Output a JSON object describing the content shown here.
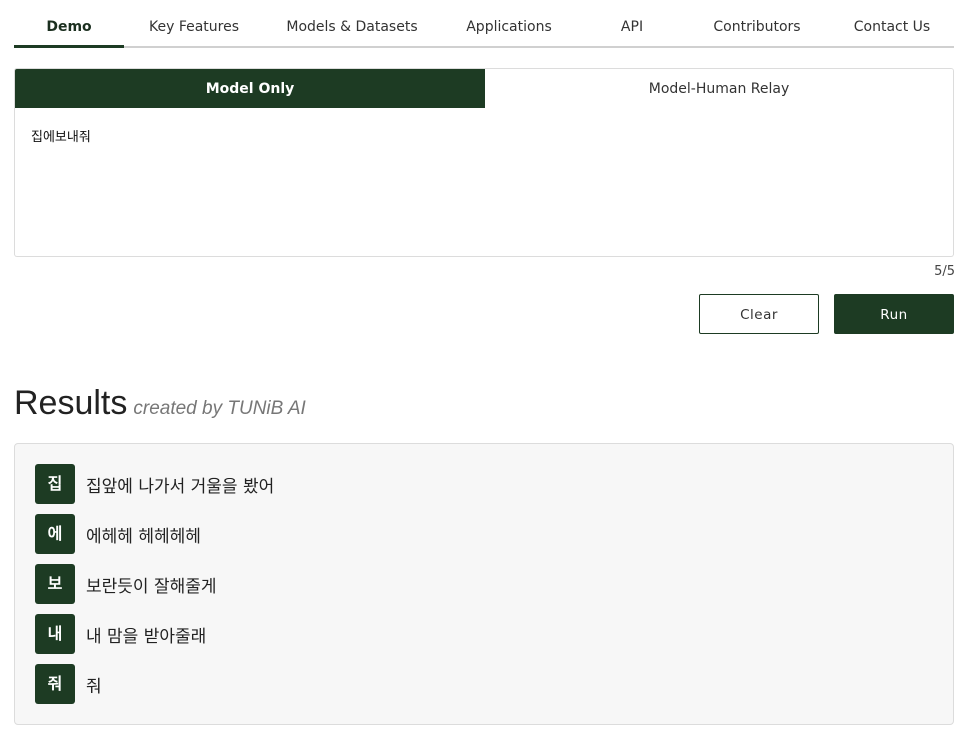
{
  "nav": {
    "tabs": [
      {
        "label": "Demo"
      },
      {
        "label": "Key Features"
      },
      {
        "label": "Models & Datasets"
      },
      {
        "label": "Applications"
      },
      {
        "label": "API"
      },
      {
        "label": "Contributors"
      },
      {
        "label": "Contact Us"
      }
    ],
    "active_tab": "Demo"
  },
  "mode": {
    "options": [
      "Model Only",
      "Model-Human Relay"
    ],
    "selected": "Model Only"
  },
  "input": {
    "value": "집에보내줘",
    "char_count": "5/5"
  },
  "actions": {
    "clear_label": "Clear",
    "run_label": "Run"
  },
  "results": {
    "title": "Results",
    "subtitle": "created by TUNiB AI",
    "lines": [
      {
        "char": "집",
        "text": "집앞에 나가서 거울을 봤어"
      },
      {
        "char": "에",
        "text": "에헤헤 헤헤헤헤"
      },
      {
        "char": "보",
        "text": "보란듯이 잘해줄게"
      },
      {
        "char": "내",
        "text": "내 맘을 받아줄래"
      },
      {
        "char": "줘",
        "text": "줘"
      }
    ]
  },
  "colors": {
    "accent": "#1d3b23",
    "panel_bg": "#f7f7f7",
    "border": "#dcdcdc"
  }
}
